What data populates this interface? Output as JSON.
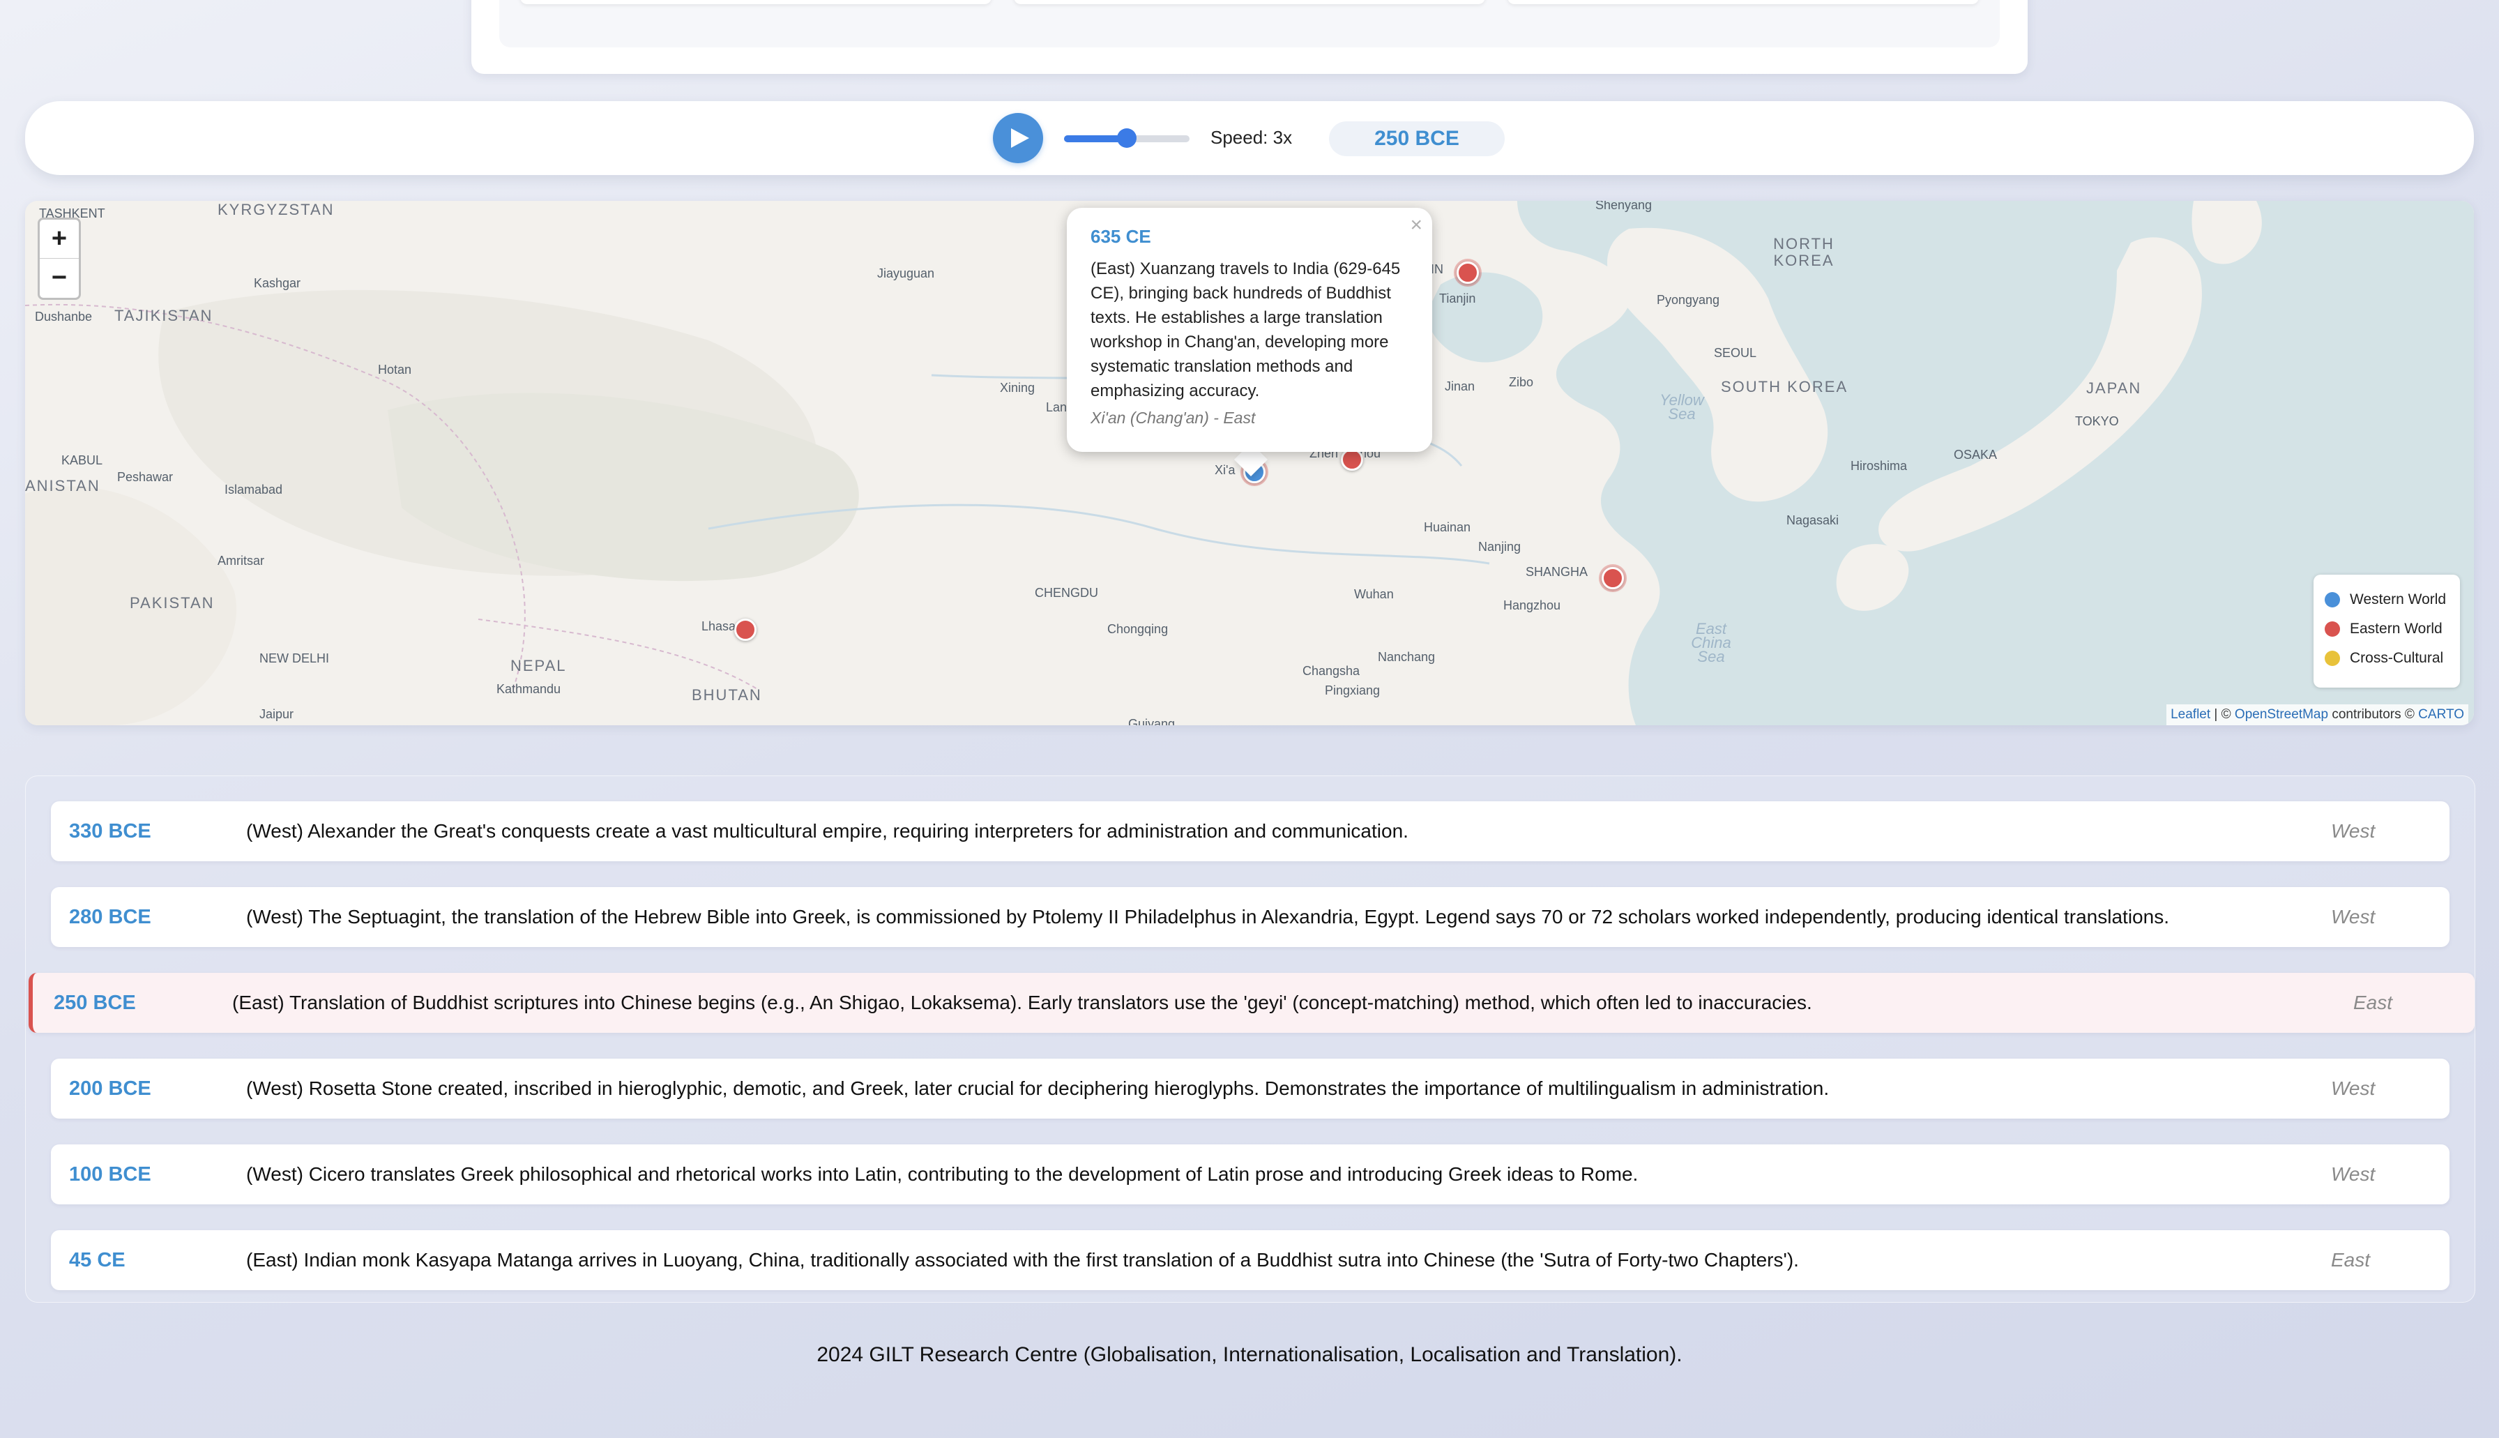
{
  "controls": {
    "play_label": "Play",
    "speed_label": "Speed: 3x",
    "speed_level": 0.5,
    "current_year": "250 BCE"
  },
  "map": {
    "zoom_in": "+",
    "zoom_out": "−",
    "labels": {
      "tashkent": "TASHKENT",
      "kyrgyzstan": "KYRGYZSTAN",
      "kashgar": "Kashgar",
      "dushanbe": "Dushanbe",
      "tajikistan": "TAJIKISTAN",
      "hotan": "Hotan",
      "kabul": "KABUL",
      "peshawar": "Peshawar",
      "afghanistan": "ANISTAN",
      "islamabad": "Islamabad",
      "amritsar": "Amritsar",
      "pakistan": "PAKISTAN",
      "new_delhi": "NEW DELHI",
      "jaipur": "Jaipur",
      "nepal": "NEPAL",
      "kathmandu": "Kathmandu",
      "bhutan": "BHUTAN",
      "lhasa": "Lhasa",
      "jiayuguan": "Jiayuguan",
      "xining": "Xining",
      "lanzhou": "Lan",
      "chengdu": "CHENGDU",
      "chongqing": "Chongqing",
      "guiyang": "Guiyang",
      "xian": "Xi'a",
      "zhengzhou": "Zhen",
      "zhengzhou_end": "hou",
      "wuhan": "Wuhan",
      "changsha": "Changsha",
      "pingxiang": "Pingxiang",
      "nanchang": "Nanchang",
      "hangzhou": "Hangzhou",
      "shanghai": "SHANGHA",
      "nanjing": "Nanjing",
      "huainan": "Huainan",
      "jinan": "Jinan",
      "zibo": "Zibo",
      "tianjin": "Tianjin",
      "beijing": "IN",
      "shenyang": "Shenyang",
      "north_korea": "NORTH KOREA",
      "pyongyang": "Pyongyang",
      "seoul": "SEOUL",
      "south_korea": "SOUTH KOREA",
      "yellow_sea": "Yellow Sea",
      "east_china_sea": "East China Sea",
      "japan": "JAPAN",
      "tokyo": "TOKYO",
      "osaka": "OSAKA",
      "hiroshima": "Hiroshima",
      "nagasaki": "Nagasaki"
    },
    "legend": [
      {
        "label": "Western World",
        "color": "#4a90d9"
      },
      {
        "label": "Eastern World",
        "color": "#d9534f"
      },
      {
        "label": "Cross-Cultural",
        "color": "#e8c23a"
      }
    ],
    "attribution": {
      "leaflet": "Leaflet",
      "sep": " | © ",
      "osm": "OpenStreetMap",
      "contrib": " contributors © ",
      "carto": "CARTO"
    },
    "popup": {
      "close": "×",
      "year": "635 CE",
      "text": "(East) Xuanzang travels to India (629-645 CE), bringing back hundreds of Buddhist texts. He establishes a large translation workshop in Chang'an, developing more systematic translation methods and emphasizing accuracy.",
      "location": "Xi'an (Chang'an) - East"
    }
  },
  "timeline": [
    {
      "year": "330 BCE",
      "text": "(West) Alexander the Great's conquests create a vast multicultural empire, requiring interpreters for administration and communication.",
      "region": "West"
    },
    {
      "year": "280 BCE",
      "text": "(West) The Septuagint, the translation of the Hebrew Bible into Greek, is commissioned by Ptolemy II Philadelphus in Alexandria, Egypt. Legend says 70 or 72 scholars worked independently, producing identical translations.",
      "region": "West"
    },
    {
      "year": "250 BCE",
      "text": "(East) Translation of Buddhist scriptures into Chinese begins (e.g., An Shigao, Lokaksema). Early translators use the 'geyi' (concept-matching) method, which often led to inaccuracies.",
      "region": "East"
    },
    {
      "year": "200 BCE",
      "text": "(West) Rosetta Stone created, inscribed in hieroglyphic, demotic, and Greek, later crucial for deciphering hieroglyphs. Demonstrates the importance of multilingualism in administration.",
      "region": "West"
    },
    {
      "year": "100 BCE",
      "text": "(West) Cicero translates Greek philosophical and rhetorical works into Latin, contributing to the development of Latin prose and introducing Greek ideas to Rome.",
      "region": "West"
    },
    {
      "year": "45 CE",
      "text": "(East) Indian monk Kasyapa Matanga arrives in Luoyang, China, traditionally associated with the first translation of a Buddhist sutra into Chinese (the 'Sutra of Forty-two Chapters').",
      "region": "East"
    }
  ],
  "footer": "2024 GILT Research Centre (Globalisation, Internationalisation, Localisation and Translation)."
}
